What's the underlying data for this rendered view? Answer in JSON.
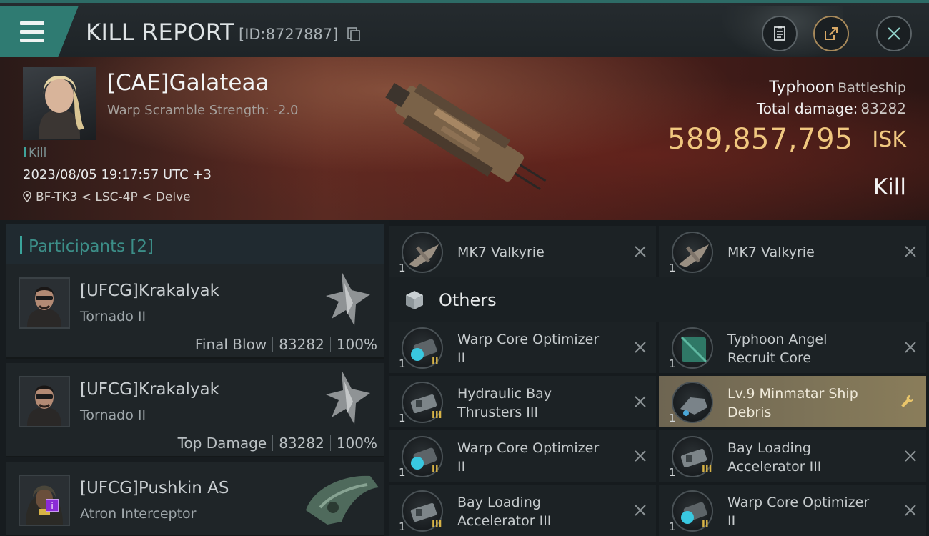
{
  "header": {
    "title": "KILL REPORT",
    "report_id": "[ID:8727887]"
  },
  "victim": {
    "name": "[CAE]Galateaa",
    "warp_scramble": "Warp Scramble Strength: -2.0",
    "tag": "Kill",
    "timestamp": "2023/08/05 19:17:57 UTC +3",
    "location": "BF-TK3 < LSC-4P < Delve",
    "ship_name": "Typhoon",
    "ship_class": "Battleship",
    "total_damage_label": "Total damage:",
    "total_damage": "83282",
    "isk_value": "589,857,795",
    "isk_unit": "ISK",
    "result": "Kill"
  },
  "participants": {
    "label": "Participants",
    "count": "[2]",
    "list": [
      {
        "name": "[UFCG]Krakalyak",
        "ship": "Tornado II",
        "role": "Final Blow",
        "damage": "83282",
        "percent": "100%"
      },
      {
        "name": "[UFCG]Krakalyak",
        "ship": "Tornado II",
        "role": "Top Damage",
        "damage": "83282",
        "percent": "100%"
      },
      {
        "name": "[UFCG]Pushkin AS",
        "ship": "Atron Interceptor",
        "badge": "i"
      }
    ]
  },
  "items": {
    "top_row": [
      {
        "name": "MK7  Valkyrie",
        "qty": "1"
      },
      {
        "name": "MK7  Valkyrie",
        "qty": "1"
      }
    ],
    "others_label": "Others",
    "others": [
      {
        "line1": "Warp Core Optimizer",
        "line2": "II",
        "qty": "1",
        "meta": "II"
      },
      {
        "line1": "Typhoon Angel",
        "line2": "Recruit Core",
        "qty": "1",
        "meta": ""
      },
      {
        "line1": "Hydraulic Bay",
        "line2": "Thrusters III",
        "qty": "1",
        "meta": "III"
      },
      {
        "line1": "Lv.9 Minmatar Ship",
        "line2": "Debris",
        "qty": "1",
        "meta": ""
      },
      {
        "line1": "Warp Core Optimizer",
        "line2": "II",
        "qty": "1",
        "meta": "II"
      },
      {
        "line1": "Bay Loading",
        "line2": "Accelerator III",
        "qty": "1",
        "meta": "III"
      },
      {
        "line1": "Bay Loading",
        "line2": "Accelerator III",
        "qty": "1",
        "meta": "III"
      },
      {
        "line1": "Warp Core Optimizer",
        "line2": "II",
        "qty": "1",
        "meta": "II"
      }
    ]
  },
  "icons": {
    "menu": "hamburger-menu-icon",
    "copy": "copy-icon",
    "clipboard": "clipboard-icon",
    "share": "share-icon",
    "close": "close-icon",
    "location": "location-pin-icon",
    "others": "cube-icon",
    "remove": "x-icon",
    "repair": "wrench-icon"
  },
  "colors": {
    "accent_teal": "#2f7b72",
    "isk_gold": "#f0c77f",
    "highlight_item": "#7e7458"
  }
}
